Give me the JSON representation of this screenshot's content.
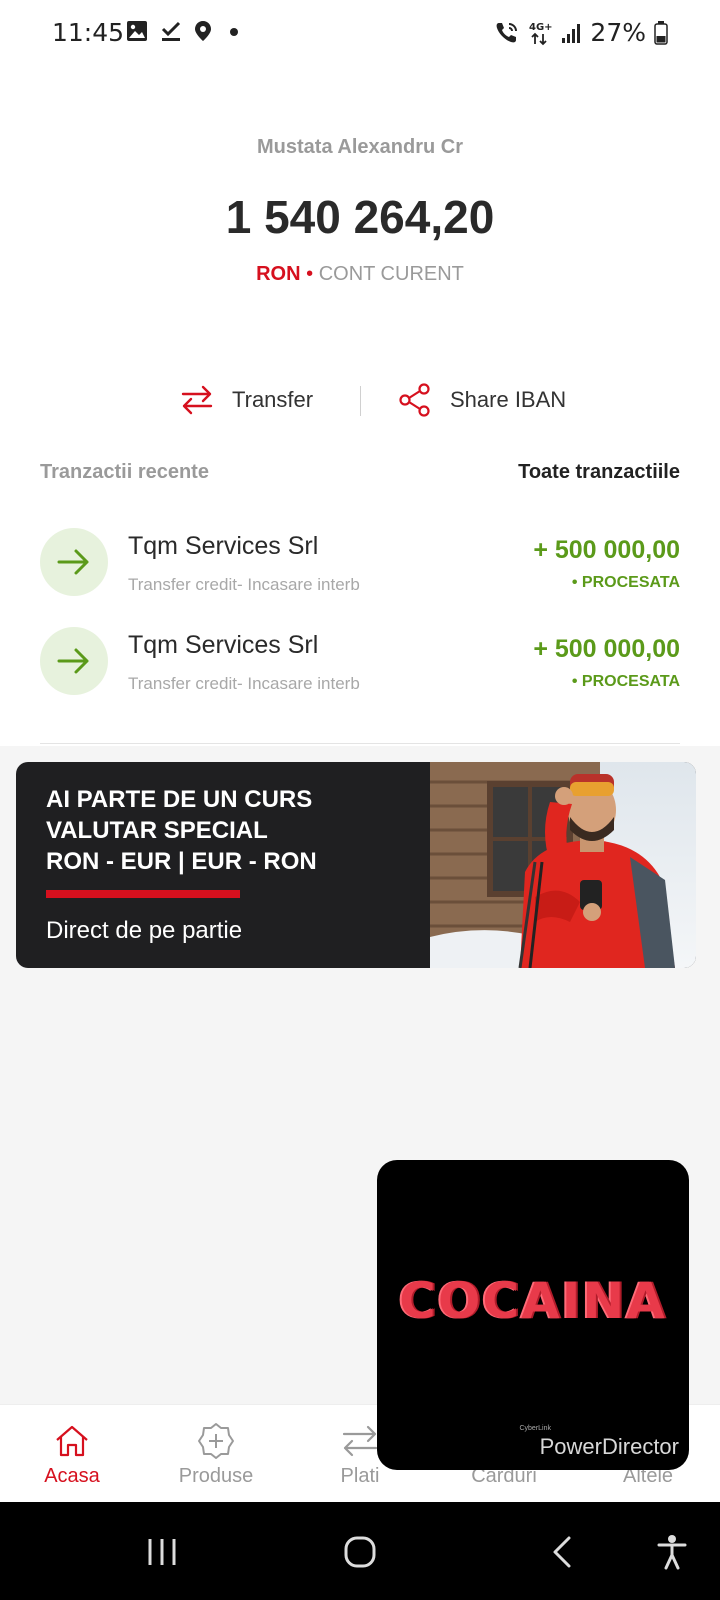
{
  "status_bar": {
    "time": "11:45",
    "network": "4G+",
    "battery": "27%"
  },
  "account": {
    "holder_name": "Mustata Alexandru Cr",
    "balance": "1 540 264,20",
    "currency": "RON",
    "separator": "•",
    "account_type": "CONT CURENT"
  },
  "actions": {
    "transfer_label": "Transfer",
    "share_label": "Share IBAN"
  },
  "recent": {
    "title": "Tranzactii recente",
    "view_all": "Toate tranzactiile",
    "transactions": [
      {
        "name": "Tqm Services Srl",
        "description": "Transfer credit- Incasare interb",
        "amount": "+ 500 000,00",
        "status": "• PROCESATA"
      },
      {
        "name": "Tqm Services Srl",
        "description": "Transfer credit- Incasare interb",
        "amount": "+ 500 000,00",
        "status": "• PROCESATA"
      }
    ]
  },
  "promo": {
    "headline": "AI PARTE DE UN CURS\nVALUTAR SPECIAL\nRON - EUR | EUR - RON",
    "subline": "Direct de pe partie"
  },
  "bottom_nav": {
    "items": [
      {
        "label": "Acasa",
        "icon": "home-icon",
        "active": true
      },
      {
        "label": "Produse",
        "icon": "products-badge-icon",
        "active": false
      },
      {
        "label": "Plati",
        "icon": "transfer-arrows-icon",
        "active": false
      },
      {
        "label": "Carduri",
        "icon": "card-icon",
        "active": false
      },
      {
        "label": "Altele",
        "icon": "more-icon",
        "active": false
      }
    ]
  },
  "video_overlay": {
    "title": "COCAINA",
    "watermark": "PowerDirector",
    "watermark_brand": "CyberLink"
  },
  "colors": {
    "brand_red": "#d6101e",
    "success_green": "#5b9a1a",
    "muted_text": "#9a9a9a"
  }
}
